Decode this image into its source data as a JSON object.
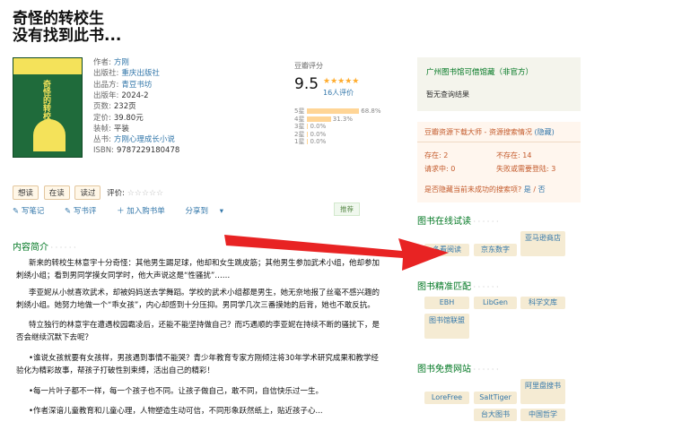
{
  "book": {
    "title_line1": "奇怪的转校生",
    "title_line2": "没有找到此书...",
    "cover": {
      "spine_text": "奇怪的转校生"
    },
    "info": [
      {
        "key": "作者:",
        "value": "方刚",
        "link": true
      },
      {
        "key": "出版社:",
        "value": "重庆出版社",
        "link": true
      },
      {
        "key": "出品方:",
        "value": "青豆书坊",
        "link": true
      },
      {
        "key": "出版年:",
        "value": "2024-2",
        "link": false
      },
      {
        "key": "页数:",
        "value": "232页",
        "link": false
      },
      {
        "key": "定价:",
        "value": "39.80元",
        "link": false
      },
      {
        "key": "装帧:",
        "value": "平装",
        "link": false
      },
      {
        "key": "丛书:",
        "value": "方刚心理成长小说",
        "link": true
      },
      {
        "key": "ISBN:",
        "value": "9787229180478",
        "link": false
      }
    ]
  },
  "rating": {
    "label": "豆瓣评分",
    "score": "9.5",
    "stars": "★★★★★",
    "count": "16人评价",
    "bars": [
      {
        "label": "5星",
        "pct": "68.8%",
        "fraction": 0.688
      },
      {
        "label": "4星",
        "pct": "31.3%",
        "fraction": 0.313
      },
      {
        "label": "3星",
        "pct": "0.0%",
        "fraction": 0
      },
      {
        "label": "2星",
        "pct": "0.0%",
        "fraction": 0
      },
      {
        "label": "1星",
        "pct": "0.0%",
        "fraction": 0
      }
    ]
  },
  "actions": {
    "want": "想读",
    "reading": "在读",
    "read": "读过",
    "rate_label": "评价:",
    "rate_stars": "☆☆☆☆☆",
    "write_note": "写笔记",
    "write_review": "写书评",
    "add_list": "加入购书单",
    "share": "分享到",
    "recommend": "推荐"
  },
  "intro": {
    "title": "内容简介",
    "p1": "新来的转校生林意宇十分奇怪：其他男生踢足球，他却和女生跳皮筋；其他男生参加武术小组，他却参加刺绣小组；看到男同学摸女同学时，他大声说这是“性骚扰”……",
    "p2": "李亚妮从小就喜欢武术，却被妈妈送去学舞蹈。学校的武术小组都是男生，她无奈地报了丝毫不感兴趣的刺绣小组。她努力地做一个“乖女孩”，内心却感到十分压抑。男同学几次三番摸她的后背，她也不敢反抗。",
    "p3": "特立独行的林意宇在遭遇校园霸凌后，还能不能坚持做自己？而巧遇顺的李亚妮在持续不断的骚扰下，是否会继续沉默下去呢？",
    "p4": "•谁说女孩就要有女孩样，男孩遇到事情不能哭？青少年教育专家方刚倾注将30年学术研究成果和教学经验化为精彩故事，帮孩子打破性别束缚，活出自己的精彩！",
    "p5": "•每一片叶子都不一样，每一个孩子也不同。让孩子做自己，敢不同，自信快乐过一生。",
    "p6": "•作者深谙儿童教育和儿童心理，人物塑造生动可信，不同形象跃然纸上，贴近孩子心..."
  },
  "library": {
    "title": "广州图书馆可借馆藏（非官方）",
    "status": "暂无查询结果"
  },
  "sources": {
    "title": "豆瓣资源下载大师 - 资源搜索情况",
    "hide": "(隐藏)",
    "exists": "存在: 2",
    "not_exists": "不存在: 14",
    "requesting": "请求中: 0",
    "failed": "失败或需要登陆: 3",
    "hide_question": "是否隐藏当前未成功的搜索项?",
    "yes": "是",
    "slash": "/",
    "no": "否"
  },
  "online_read": {
    "title": "图书在线试读",
    "items": [
      "多看阅读",
      "京东数字",
      "亚马逊商店"
    ]
  },
  "precise": {
    "title": "图书精准匹配",
    "items": [
      "EBH",
      "LibGen",
      "科学文库",
      "图书馆联盟"
    ]
  },
  "free": {
    "title": "图书免费网站",
    "items": [
      "LoreFree",
      "SaltTiger",
      "阿里盘搜书",
      "台大图书",
      "中国哲学"
    ]
  }
}
